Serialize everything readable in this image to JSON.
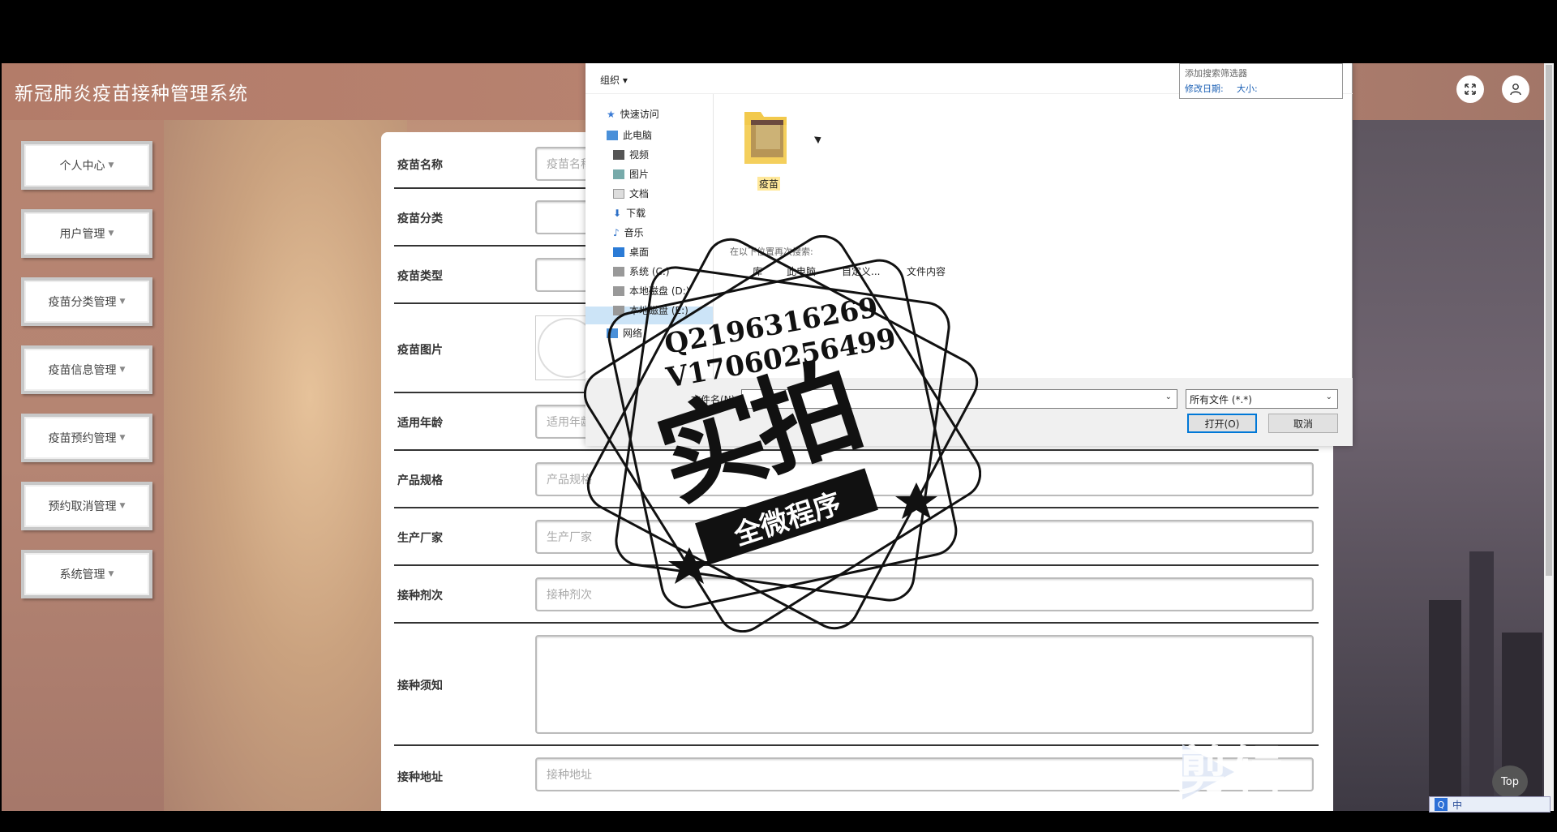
{
  "app": {
    "title": "新冠肺炎疫苗接种管理系统"
  },
  "sidebar": {
    "items": [
      {
        "label": "个人中心"
      },
      {
        "label": "用户管理"
      },
      {
        "label": "疫苗分类管理"
      },
      {
        "label": "疫苗信息管理"
      },
      {
        "label": "疫苗预约管理"
      },
      {
        "label": "预约取消管理"
      },
      {
        "label": "系统管理"
      }
    ]
  },
  "form": {
    "rows": [
      {
        "label": "疫苗名称",
        "placeholder": "疫苗名称"
      },
      {
        "label": "疫苗分类",
        "placeholder": ""
      },
      {
        "label": "疫苗类型",
        "placeholder": ""
      },
      {
        "label": "疫苗图片",
        "placeholder": ""
      },
      {
        "label": "适用年龄",
        "placeholder": "适用年龄"
      },
      {
        "label": "产品规格",
        "placeholder": "产品规格"
      },
      {
        "label": "生产厂家",
        "placeholder": "生产厂家"
      },
      {
        "label": "接种剂次",
        "placeholder": "接种剂次"
      },
      {
        "label": "接种须知",
        "placeholder": ""
      },
      {
        "label": "接种地址",
        "placeholder": "接种地址"
      }
    ]
  },
  "dialog": {
    "organize_label": "组织",
    "filter": {
      "title": "添加搜索筛选器",
      "date_label": "修改日期:",
      "size_label": "大小:"
    },
    "nav": [
      {
        "label": "快速访问"
      },
      {
        "label": "此电脑"
      },
      {
        "label": "视频"
      },
      {
        "label": "图片"
      },
      {
        "label": "文档"
      },
      {
        "label": "下载"
      },
      {
        "label": "音乐"
      },
      {
        "label": "桌面"
      },
      {
        "label": "系统 (C:)"
      },
      {
        "label": "本地磁盘 (D:)"
      },
      {
        "label": "本地磁盘 (E:)"
      },
      {
        "label": "网络"
      }
    ],
    "folder_name": "疫苗",
    "search_again_title": "在以下位置再次搜索:",
    "search_locations": [
      "库",
      "此电脑",
      "自定义...",
      "文件内容"
    ],
    "filename_label": "文件名(N):",
    "filetype": "所有文件 (*.*)",
    "open_button": "打开(O)",
    "cancel_button": "取消"
  },
  "watermark": {
    "qq": "Q2196316269",
    "vx": "V17060256499",
    "big": "实拍",
    "ribbon": "全微程序",
    "editor": "剪辑"
  },
  "top_button": "Top",
  "ime": {
    "label": "中"
  },
  "colors": {
    "accent_blue": "#0078d7",
    "header_bg": "#b37c69",
    "selected_nav": "#cce4f7",
    "folder_label_bg": "#ffe89a"
  }
}
